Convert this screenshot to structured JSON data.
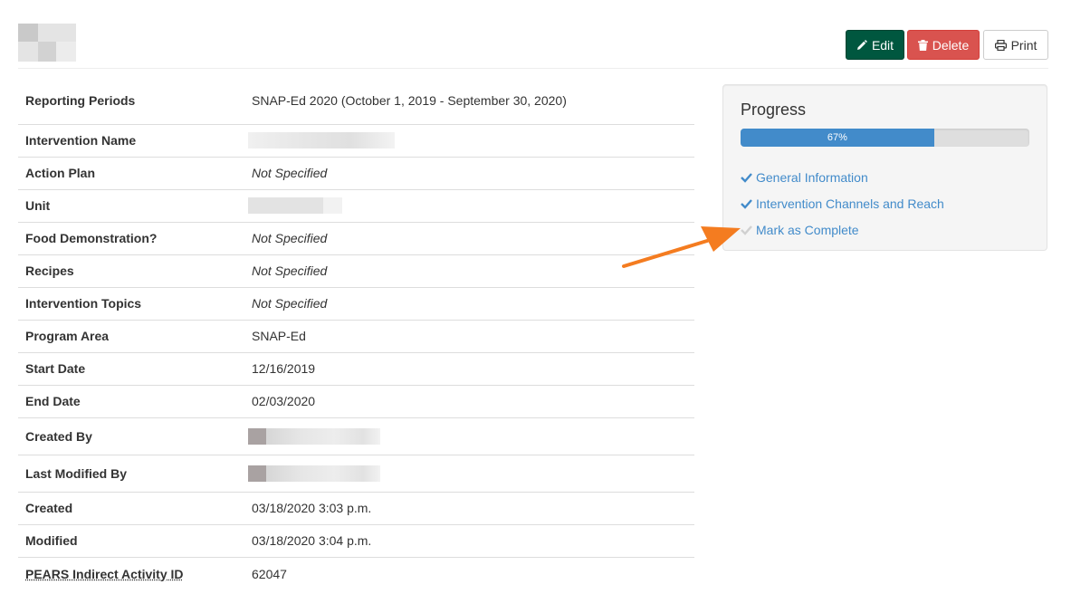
{
  "header": {
    "buttons": {
      "edit": "Edit",
      "delete": "Delete",
      "print": "Print"
    }
  },
  "details": {
    "rows": [
      {
        "label": "Reporting Periods",
        "value": "SNAP-Ed 2020 (October 1, 2019 - September 30, 2020)"
      },
      {
        "label": "Intervention Name",
        "value": ""
      },
      {
        "label": "Action Plan",
        "value": "Not Specified"
      },
      {
        "label": "Unit",
        "value": ""
      },
      {
        "label": "Food Demonstration?",
        "value": "Not Specified"
      },
      {
        "label": "Recipes",
        "value": "Not Specified"
      },
      {
        "label": "Intervention Topics",
        "value": "Not Specified"
      },
      {
        "label": "Program Area",
        "value": "SNAP-Ed"
      },
      {
        "label": "Start Date",
        "value": "12/16/2019"
      },
      {
        "label": "End Date",
        "value": "02/03/2020"
      },
      {
        "label": "Created By",
        "value": ""
      },
      {
        "label": "Last Modified By",
        "value": ""
      },
      {
        "label": "Created",
        "value": "03/18/2020 3:03 p.m."
      },
      {
        "label": "Modified",
        "value": "03/18/2020 3:04 p.m."
      },
      {
        "label": "PEARS Indirect Activity ID",
        "value": "62047"
      }
    ]
  },
  "progress": {
    "title": "Progress",
    "percent_label": "67%",
    "fraction": 0.67,
    "steps": [
      {
        "label": "General Information",
        "complete": true
      },
      {
        "label": "Intervention Channels and Reach",
        "complete": true
      },
      {
        "label": "Mark as Complete",
        "complete": false
      }
    ]
  },
  "colors": {
    "edit_button": "#00573f",
    "delete_button": "#d9534f",
    "link": "#428bca",
    "progress_fill": "#428bca",
    "annotation_arrow": "#f47c20"
  },
  "icons": {
    "edit": "pencil-icon",
    "delete": "trash-icon",
    "print": "printer-icon",
    "step": "check-icon",
    "annotation": "arrow-icon"
  }
}
